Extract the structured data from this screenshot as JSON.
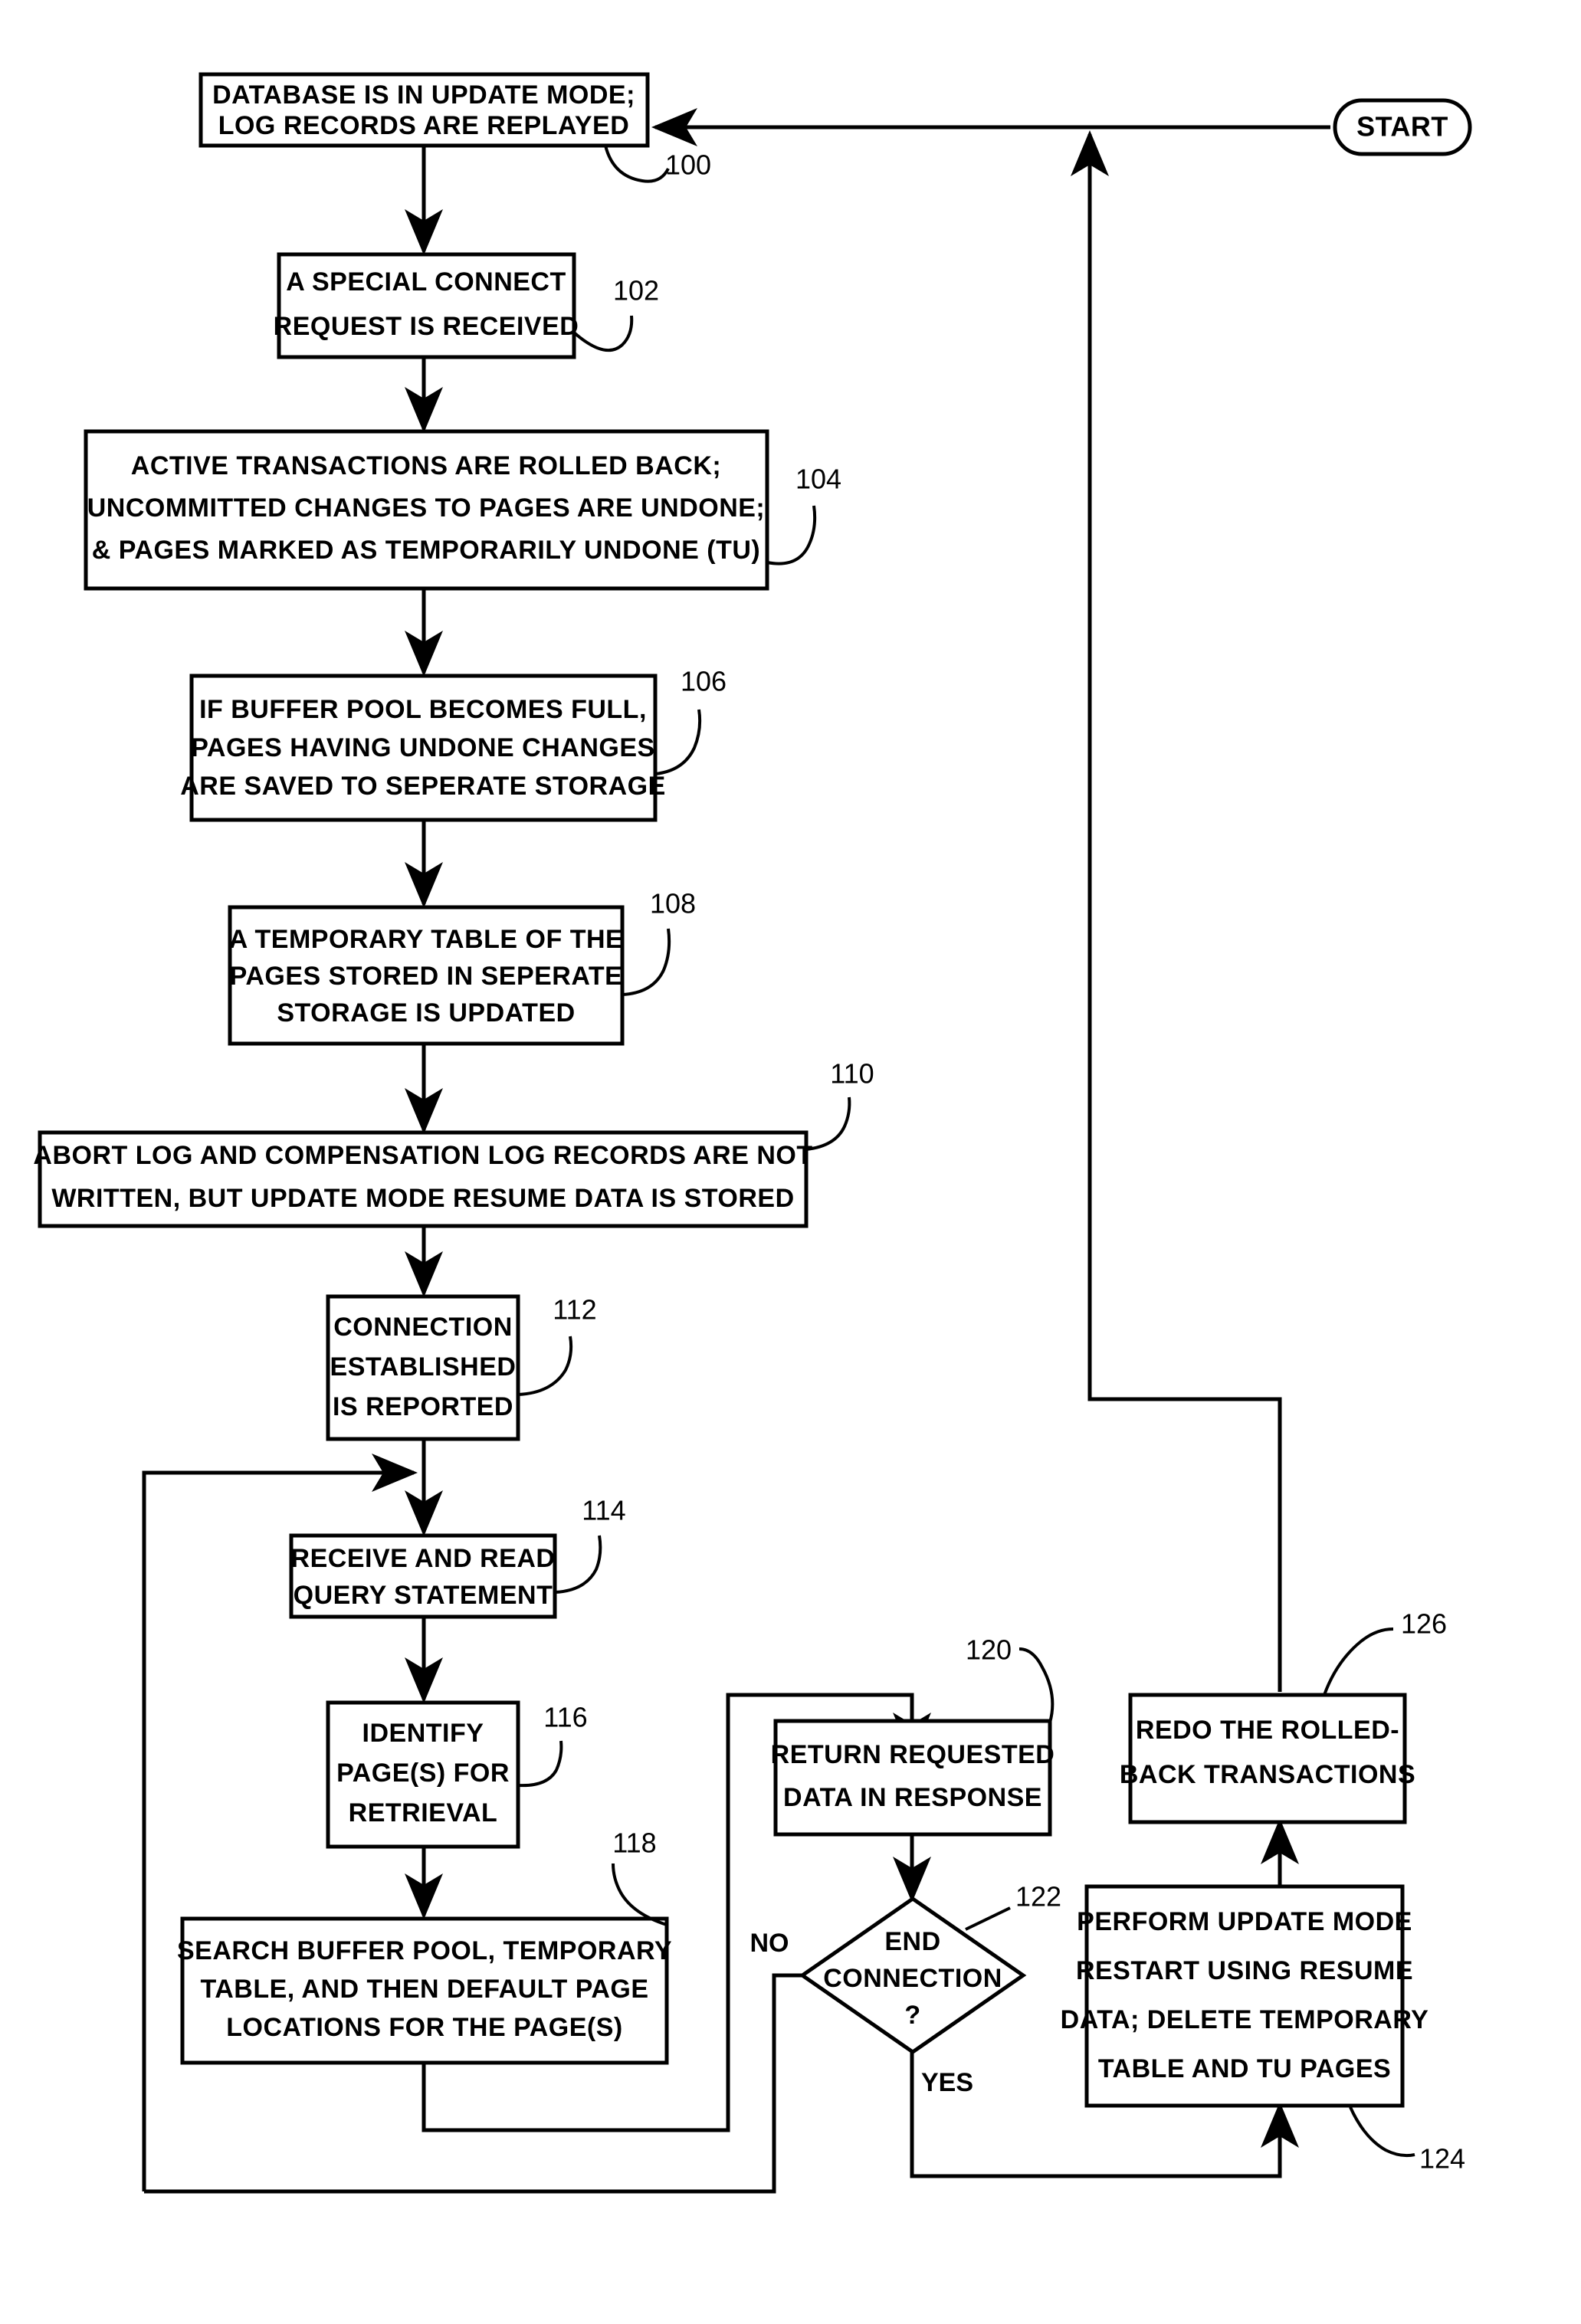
{
  "figure": {
    "type": "flowchart",
    "title": "Database update mode connection and query flowchart",
    "start_label": "START",
    "decision_labels": {
      "no": "NO",
      "yes": "YES"
    }
  },
  "nodes": [
    {
      "ref": "100",
      "shape": "process",
      "lines": [
        "DATABASE IS IN UPDATE MODE;",
        "LOG RECORDS ARE REPLAYED"
      ]
    },
    {
      "ref": "102",
      "shape": "process",
      "lines": [
        "A SPECIAL CONNECT",
        "REQUEST IS RECEIVED"
      ]
    },
    {
      "ref": "104",
      "shape": "process",
      "lines": [
        "ACTIVE TRANSACTIONS ARE ROLLED BACK;",
        "UNCOMMITTED CHANGES TO PAGES ARE UNDONE;",
        "& PAGES MARKED AS TEMPORARILY UNDONE (TU)"
      ]
    },
    {
      "ref": "106",
      "shape": "process",
      "lines": [
        "IF BUFFER POOL BECOMES FULL,",
        "PAGES HAVING UNDONE CHANGES",
        "ARE SAVED TO SEPERATE STORAGE"
      ]
    },
    {
      "ref": "108",
      "shape": "process",
      "lines": [
        "A TEMPORARY TABLE OF THE",
        "PAGES STORED IN SEPERATE",
        "STORAGE IS UPDATED"
      ]
    },
    {
      "ref": "110",
      "shape": "process",
      "lines": [
        "ABORT LOG AND COMPENSATION LOG RECORDS ARE NOT",
        "WRITTEN, BUT UPDATE MODE RESUME DATA IS STORED"
      ]
    },
    {
      "ref": "112",
      "shape": "process",
      "lines": [
        "CONNECTION",
        "ESTABLISHED",
        "IS REPORTED"
      ]
    },
    {
      "ref": "114",
      "shape": "process",
      "lines": [
        "RECEIVE AND READ",
        "QUERY STATEMENT"
      ]
    },
    {
      "ref": "116",
      "shape": "process",
      "lines": [
        "IDENTIFY",
        "PAGE(S) FOR",
        "RETRIEVAL"
      ]
    },
    {
      "ref": "118",
      "shape": "process",
      "lines": [
        "SEARCH BUFFER POOL, TEMPORARY",
        "TABLE, AND THEN DEFAULT PAGE",
        "LOCATIONS FOR THE PAGE(S)"
      ]
    },
    {
      "ref": "120",
      "shape": "process",
      "lines": [
        "RETURN REQUESTED",
        "DATA IN RESPONSE"
      ]
    },
    {
      "ref": "122",
      "shape": "decision",
      "lines": [
        "END",
        "CONNECTION",
        "?"
      ]
    },
    {
      "ref": "124",
      "shape": "process",
      "lines": [
        "PERFORM UPDATE MODE",
        "RESTART USING RESUME",
        "DATA; DELETE TEMPORARY",
        "TABLE AND TU PAGES"
      ]
    },
    {
      "ref": "126",
      "shape": "process",
      "lines": [
        "REDO THE ROLLED-",
        "BACK TRANSACTIONS"
      ]
    }
  ],
  "colors": {
    "stroke": "#000000",
    "fill": "#ffffff",
    "text": "#000000"
  }
}
